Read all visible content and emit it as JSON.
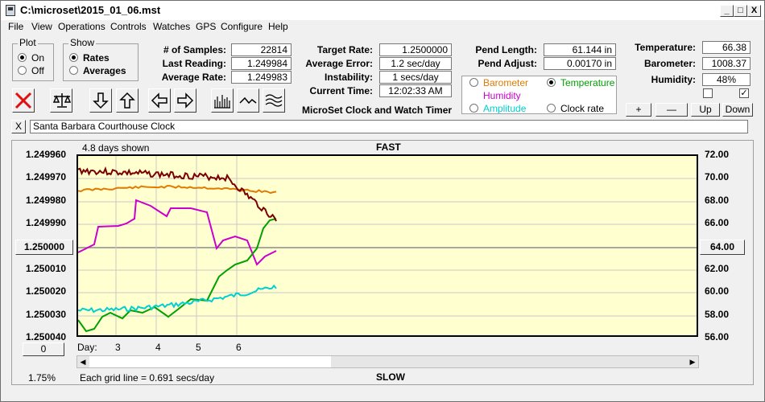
{
  "window": {
    "title": "C:\\microset\\2015_01_06.mst",
    "minimize": "_",
    "maximize": "□",
    "close": "X"
  },
  "menu": [
    "File",
    "View",
    "Operations",
    "Controls",
    "Watches",
    "GPS",
    "Configure",
    "Help"
  ],
  "plot_group": {
    "title": "Plot",
    "options": [
      "On",
      "Off"
    ],
    "selected": "On"
  },
  "show_group": {
    "title": "Show",
    "options": [
      "Rates",
      "Averages"
    ],
    "selected": "Rates"
  },
  "readouts": {
    "samples_label": "# of Samples:",
    "samples": "22814",
    "last_label": "Last Reading:",
    "last": "1.249984",
    "avg_rate_label": "Average Rate:",
    "avg_rate": "1.249983",
    "target_label": "Target Rate:",
    "target": "1.2500000",
    "avg_error_label": "Average Error:",
    "avg_error": "1.2 sec/day",
    "instability_label": "Instability:",
    "instability": "1 secs/day",
    "current_time_label": "Current Time:",
    "current_time": "12:02:33 AM",
    "pend_length_label": "Pend Length:",
    "pend_length": "61.144 in",
    "pend_adjust_label": "Pend Adjust:",
    "pend_adjust": "0.00170 in",
    "temperature_label": "Temperature:",
    "temperature": "66.38",
    "barometer_label": "Barometer:",
    "barometer": "1008.37",
    "humidity_label": "Humidity:",
    "humidity": "48%"
  },
  "app_name": "MicroSet Clock and Watch Timer",
  "sensor_options": [
    {
      "label": "Barometer",
      "color": "#e07a00",
      "selected": false
    },
    {
      "label": "Temperature",
      "color": "#00a000",
      "selected": true
    },
    {
      "label": "Humidity",
      "color": "#cc00cc",
      "selected": false
    },
    {
      "label": "Amplitude",
      "color": "#00d0d0",
      "selected": false
    },
    {
      "label": "Clock rate",
      "color": "#000000",
      "selected": false
    }
  ],
  "scale_buttons": {
    "plus": "+",
    "minus": "—",
    "up": "Up",
    "down": "Down"
  },
  "checkboxes": {
    "left": "",
    "right": "✓"
  },
  "clock_name": "Santa Barbara Courthouse Clock",
  "clear_button": "X",
  "plot": {
    "days_shown": "4.8 days shown",
    "fast": "FAST",
    "slow": "SLOW",
    "left_axis": [
      "1.249960",
      "1.249970",
      "1.249980",
      "1.249990",
      "1.250000",
      "1.250010",
      "1.250020",
      "1.250030",
      "1.250040"
    ],
    "right_axis": [
      "72.00",
      "70.00",
      "68.00",
      "66.00",
      "64.00",
      "62.00",
      "60.00",
      "58.00",
      "56.00"
    ],
    "left_center_button": "1.250000",
    "right_center_button": "64.00",
    "zero_button": "0",
    "day_label": "Day:",
    "days": [
      "3",
      "4",
      "5",
      "6"
    ],
    "percent": "1.75%",
    "grid_note": "Each grid line = 0.691 secs/day"
  }
}
